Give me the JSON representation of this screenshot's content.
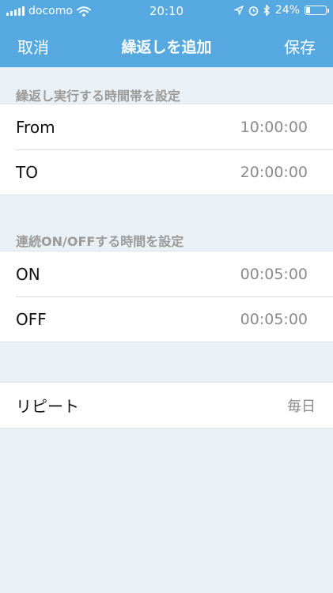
{
  "status_bar": {
    "carrier": "docomo",
    "time": "20:10",
    "battery": "24%",
    "battery_level": 0.24,
    "icons": [
      "signal-bars-icon",
      "wifi-icon",
      "location-arrow-icon",
      "alarm-clock-icon",
      "bluetooth-icon",
      "battery-icon"
    ]
  },
  "nav": {
    "cancel_label": "取消",
    "title": "繰返しを追加",
    "save_label": "保存"
  },
  "sections": {
    "time_range": {
      "header": "繰返し実行する時間帯を設定",
      "rows": [
        {
          "label": "From",
          "value": "10:00:00"
        },
        {
          "label": "TO",
          "value": "20:00:00"
        }
      ]
    },
    "on_off": {
      "header": "連続ON/OFFする時間を設定",
      "rows": [
        {
          "label": "ON",
          "value": "00:05:00"
        },
        {
          "label": "OFF",
          "value": "00:05:00"
        }
      ]
    },
    "repeat": {
      "label": "リピート",
      "value": "毎日"
    }
  },
  "colors": {
    "header_bg": "#55a9e0",
    "page_bg": "#eaf1f6",
    "row_bg": "#ffffff",
    "value_text": "#8b8b8b",
    "section_header_text": "#9a9a9a"
  }
}
